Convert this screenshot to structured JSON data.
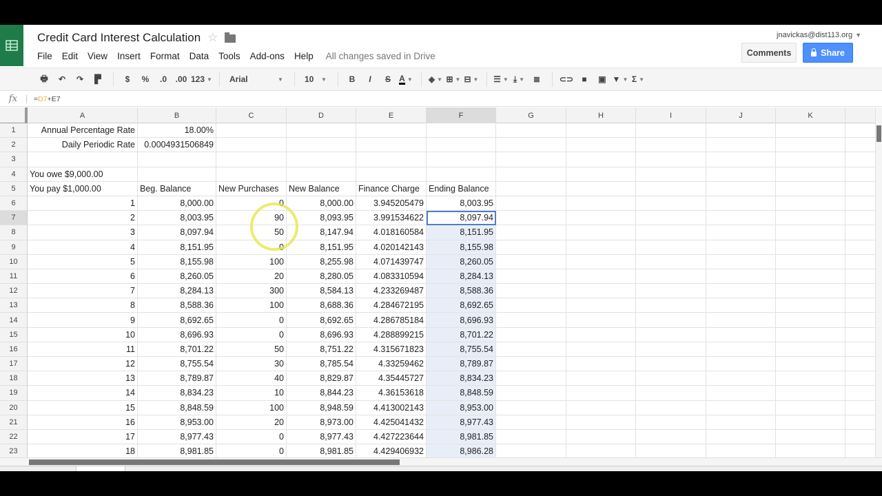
{
  "doc": {
    "title": "Credit Card Interest Calculation",
    "status": "All changes saved in Drive",
    "account": "jnavickas@dist113.org"
  },
  "menu": [
    "File",
    "Edit",
    "View",
    "Insert",
    "Format",
    "Data",
    "Tools",
    "Add-ons",
    "Help"
  ],
  "buttons": {
    "comments": "Comments",
    "share": "Share"
  },
  "toolbar": {
    "currency": "$",
    "percent": "%",
    "dec_less": ".0",
    "dec_more": ".00",
    "more_formats": "123",
    "font": "Arial",
    "font_size": "10",
    "bold": "B",
    "italic": "I",
    "strike": "S",
    "text_color": "A",
    "sum": "Σ"
  },
  "formula_bar": {
    "prefix": "=",
    "ref": "D7",
    "rest": "+E7",
    "fx": "fx"
  },
  "columns": [
    "A",
    "B",
    "C",
    "D",
    "E",
    "F",
    "G",
    "H",
    "I",
    "J",
    "K"
  ],
  "selected_column": "F",
  "selected_row": 7,
  "rows": [
    {
      "n": "1",
      "A": "Annual Percentage Rate",
      "B": "18.00%",
      "C": "",
      "D": "",
      "E": "",
      "F": ""
    },
    {
      "n": "2",
      "A": "Daily Periodic Rate",
      "B": "0.0004931506849",
      "C": "",
      "D": "",
      "E": "",
      "F": ""
    },
    {
      "n": "3",
      "A": "",
      "B": "",
      "C": "",
      "D": "",
      "E": "",
      "F": ""
    },
    {
      "n": "4",
      "A": "You owe $9,000.00",
      "B": "",
      "C": "",
      "D": "",
      "E": "",
      "F": ""
    },
    {
      "n": "5",
      "A": "You pay $1,000.00",
      "B": "Beg. Balance",
      "C": "New Purchases",
      "D": "New Balance",
      "E": "Finance Charge",
      "F": "Ending Balance"
    },
    {
      "n": "6",
      "A": "1",
      "B": "8,000.00",
      "C": "0",
      "D": "8,000.00",
      "E": "3.945205479",
      "F": "8,003.95"
    },
    {
      "n": "7",
      "A": "2",
      "B": "8,003.95",
      "C": "90",
      "D": "8,093.95",
      "E": "3.991534622",
      "F": "8,097.94"
    },
    {
      "n": "8",
      "A": "3",
      "B": "8,097.94",
      "C": "50",
      "D": "8,147.94",
      "E": "4.018160584",
      "F": "8,151.95"
    },
    {
      "n": "9",
      "A": "4",
      "B": "8,151.95",
      "C": "0",
      "D": "8,151.95",
      "E": "4.020142143",
      "F": "8,155.98"
    },
    {
      "n": "10",
      "A": "5",
      "B": "8,155.98",
      "C": "100",
      "D": "8,255.98",
      "E": "4.071439747",
      "F": "8,260.05"
    },
    {
      "n": "11",
      "A": "6",
      "B": "8,260.05",
      "C": "20",
      "D": "8,280.05",
      "E": "4.083310594",
      "F": "8,284.13"
    },
    {
      "n": "12",
      "A": "7",
      "B": "8,284.13",
      "C": "300",
      "D": "8,584.13",
      "E": "4.233269487",
      "F": "8,588.36"
    },
    {
      "n": "13",
      "A": "8",
      "B": "8,588.36",
      "C": "100",
      "D": "8,688.36",
      "E": "4.284672195",
      "F": "8,692.65"
    },
    {
      "n": "14",
      "A": "9",
      "B": "8,692.65",
      "C": "0",
      "D": "8,692.65",
      "E": "4.286785184",
      "F": "8,696.93"
    },
    {
      "n": "15",
      "A": "10",
      "B": "8,696.93",
      "C": "0",
      "D": "8,696.93",
      "E": "4.288899215",
      "F": "8,701.22"
    },
    {
      "n": "16",
      "A": "11",
      "B": "8,701.22",
      "C": "50",
      "D": "8,751.22",
      "E": "4.315671823",
      "F": "8,755.54"
    },
    {
      "n": "17",
      "A": "12",
      "B": "8,755.54",
      "C": "30",
      "D": "8,785.54",
      "E": "4.33259462",
      "F": "8,789.87"
    },
    {
      "n": "18",
      "A": "13",
      "B": "8,789.87",
      "C": "40",
      "D": "8,829.87",
      "E": "4.35445727",
      "F": "8,834.23"
    },
    {
      "n": "19",
      "A": "14",
      "B": "8,834.23",
      "C": "10",
      "D": "8,844.23",
      "E": "4.36153618",
      "F": "8,848.59"
    },
    {
      "n": "20",
      "A": "15",
      "B": "8,848.59",
      "C": "100",
      "D": "8,948.59",
      "E": "4.413002143",
      "F": "8,953.00"
    },
    {
      "n": "21",
      "A": "16",
      "B": "8,953.00",
      "C": "20",
      "D": "8,973.00",
      "E": "4.425041432",
      "F": "8,977.43"
    },
    {
      "n": "22",
      "A": "17",
      "B": "8,977.43",
      "C": "0",
      "D": "8,977.43",
      "E": "4.427223644",
      "F": "8,981.85"
    },
    {
      "n": "23",
      "A": "18",
      "B": "8,981.85",
      "C": "0",
      "D": "8,981.85",
      "E": "4.429406932",
      "F": "8,986.28"
    }
  ]
}
